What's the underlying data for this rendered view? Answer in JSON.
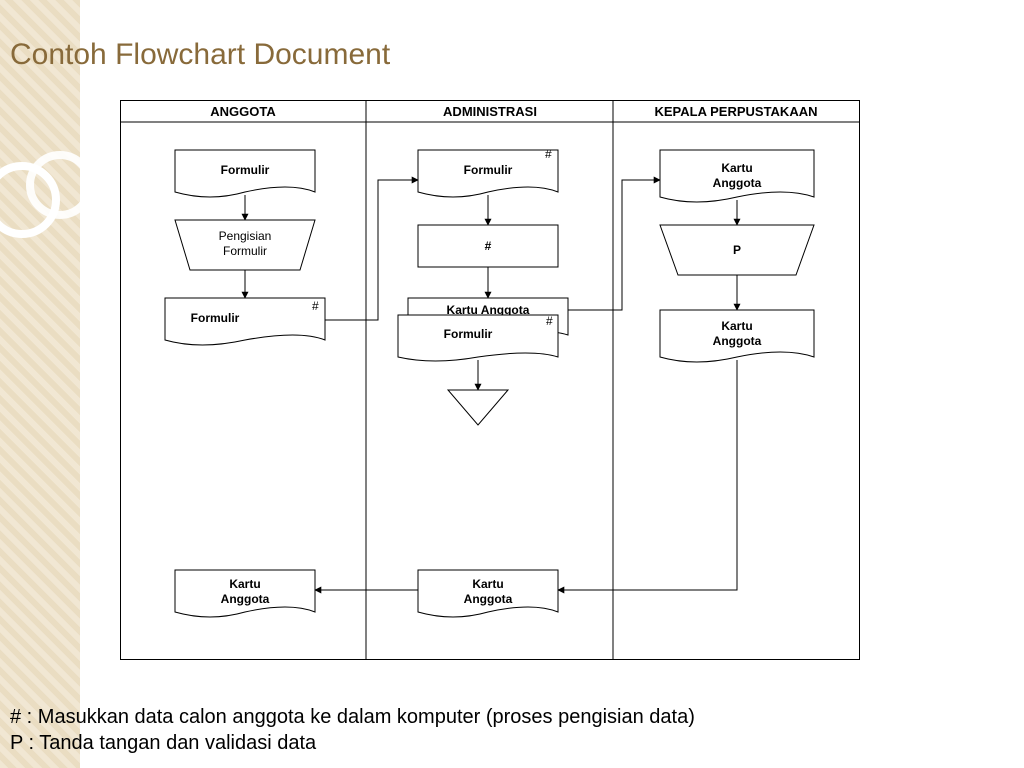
{
  "title": "Contoh Flowchart Document",
  "swimlanes": {
    "col1": "ANGGOTA",
    "col2": "ADMINISTRASI",
    "col3": "KEPALA PERPUSTAKAAN"
  },
  "labels": {
    "formulir": "Formulir",
    "pengisian_l1": "Pengisian",
    "pengisian_l2": "Formulir",
    "hash": "#",
    "kartu_l1": "Kartu",
    "kartu_l2": "Anggota",
    "kartu_anggota": "Kartu Anggota",
    "p": "P"
  },
  "legend": {
    "hash": "# : Masukkan data calon anggota ke dalam komputer (proses pengisian data)",
    "p": "P : Tanda tangan dan validasi data"
  }
}
